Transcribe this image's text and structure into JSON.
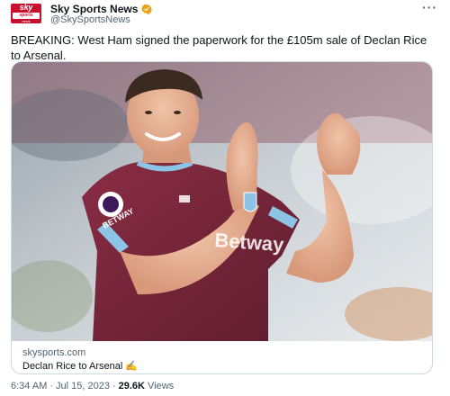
{
  "account": {
    "display_name": "Sky Sports News",
    "handle": "@SkySportsNews",
    "avatar_text_top": "sky",
    "avatar_text_mid": "sports",
    "avatar_text_bottom": "news"
  },
  "tweet": {
    "text": "BREAKING: West Ham signed the paperwork for the £105m sale of Declan Rice to Arsenal.",
    "more_label": "···"
  },
  "card": {
    "domain": "skysports.com",
    "title": "Declan Rice to Arsenal ✍️",
    "photo_shirt_text": "Betway",
    "photo_sleeve_text": "BETWAY"
  },
  "meta": {
    "time": "6:34 AM",
    "sep1": "·",
    "date": "Jul 15, 2023",
    "sep2": "·",
    "views_count": "29.6K",
    "views_label": "Views"
  },
  "colors": {
    "verified": "#e8a317",
    "brand_red": "#c8102e",
    "shirt": "#7a263a",
    "shirt_trim": "#8cc4e6"
  }
}
